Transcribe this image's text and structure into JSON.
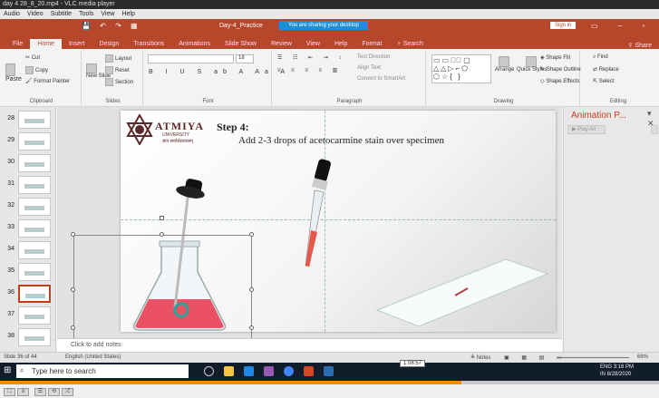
{
  "vlc": {
    "window_title": "day 4 28_8_20.mp4 - VLC media player",
    "menu": [
      "Audio",
      "Video",
      "Subtitle",
      "Tools",
      "View",
      "Help"
    ],
    "seek_time": "1:08:57",
    "progress": 0.7
  },
  "ppt": {
    "doc_title": "Day-4_Practice",
    "share_banner": "You are sharing your desktop",
    "sign_in": "Sign in",
    "tabs": [
      "File",
      "Home",
      "Insert",
      "Design",
      "Transitions",
      "Animations",
      "Slide Show",
      "Review",
      "View",
      "Help",
      "Format",
      "Search"
    ],
    "active_tab": "Home",
    "share_label": "Share",
    "ribbon": {
      "cut": "Cut",
      "copy": "Copy",
      "format_painter": "Format Painter",
      "paste": "Paste",
      "new_slide": "New Slide",
      "layout": "Layout",
      "reset": "Reset",
      "section": "Section",
      "font_size": "18",
      "text_direction": "Text Direction",
      "align_text": "Align Text",
      "convert_smartart": "Convert to SmartArt",
      "arrange": "Arrange",
      "quick_styles": "Quick Styles",
      "shape_fill": "Shape Fill",
      "shape_outline": "Shape Outline",
      "shape_effects": "Shape Effects",
      "find": "Find",
      "replace": "Replace",
      "select": "Select",
      "groups": [
        "Clipboard",
        "Slides",
        "Font",
        "Paragraph",
        "Drawing",
        "Editing"
      ]
    },
    "thumbnails": [
      "28",
      "29",
      "30",
      "31",
      "32",
      "33",
      "34",
      "35",
      "36",
      "37",
      "38"
    ],
    "selected_slide": "36",
    "slide": {
      "logo_name": "ATMIYA",
      "logo_sub": "UNIVERSITY",
      "logo_sub2": "ज्ञानं सर्वार्थसाधकम्",
      "step_title": "Step 4:",
      "step_text": "Add 2-3 drops of acetocarmine stain over specimen"
    },
    "notes_placeholder": "Click to add notes",
    "animation_pane": {
      "title": "Animation P...",
      "play": "Play All"
    },
    "status": {
      "slide_info": "Slide 36 of 44",
      "language": "English (United States)",
      "notes": "Notes",
      "zoom": "66%"
    }
  },
  "taskbar": {
    "search_placeholder": "Type here to search",
    "lang": "ENG",
    "region": "IN",
    "time": "3:16 PM",
    "date": "8/28/2020"
  },
  "colors": {
    "ppt_accent": "#b7472a",
    "vlc_progress": "#ff8800",
    "stain": "#e8344a"
  }
}
